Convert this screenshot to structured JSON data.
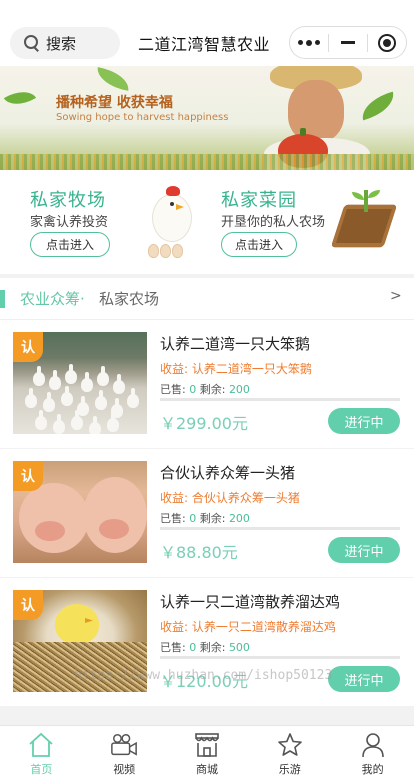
{
  "header": {
    "search_label": "搜索",
    "app_title": "二道江湾智慧农业"
  },
  "banner": {
    "slogan": "播种希望 收获幸福",
    "slogan_en": "Sowing hope to harvest happiness"
  },
  "entries": [
    {
      "title": "私家牧场",
      "subtitle": "家禽认养投资",
      "button": "点击进入"
    },
    {
      "title": "私家菜园",
      "subtitle": "开垦你的私人农场",
      "button": "点击进入"
    }
  ],
  "section": {
    "primary": "农业众筹·",
    "secondary": "私家农场",
    "more": ">"
  },
  "products": [
    {
      "badge": "认",
      "name": "认养二道湾一只大笨鹅",
      "income_label": "收益:",
      "income_value": "认养二道湾一只大笨鹅",
      "sold_label": "已售:",
      "sold": "0",
      "remain_label": "剩余:",
      "remain": "200",
      "price": "￥299.00元",
      "status": "进行中",
      "progress": 0
    },
    {
      "badge": "认",
      "name": "合伙认养众筹一头猪",
      "income_label": "收益:",
      "income_value": "合伙认养众筹一头猪",
      "sold_label": "已售:",
      "sold": "0",
      "remain_label": "剩余:",
      "remain": "200",
      "price": "￥88.80元",
      "status": "进行中",
      "progress": 0
    },
    {
      "badge": "认",
      "name": "认养一只二道湾散养溜达鸡",
      "income_label": "收益:",
      "income_value": "认养一只二道湾散养溜达鸡",
      "sold_label": "已售:",
      "sold": "0",
      "remain_label": "剩余:",
      "remain": "500",
      "price": "￥120.00元",
      "status": "进行中",
      "progress": 0
    }
  ],
  "watermark": "https://www.huzhan.com/ishop50123",
  "tabs": [
    {
      "label": "首页",
      "icon": "home-icon",
      "active": true
    },
    {
      "label": "视频",
      "icon": "video-camera-icon",
      "active": false
    },
    {
      "label": "商城",
      "icon": "shop-icon",
      "active": false
    },
    {
      "label": "乐游",
      "icon": "star-icon",
      "active": false
    },
    {
      "label": "我的",
      "icon": "user-icon",
      "active": false
    }
  ],
  "colors": {
    "accent": "#62cfac",
    "income": "#ef7c2f",
    "badge": "#f39b25"
  }
}
